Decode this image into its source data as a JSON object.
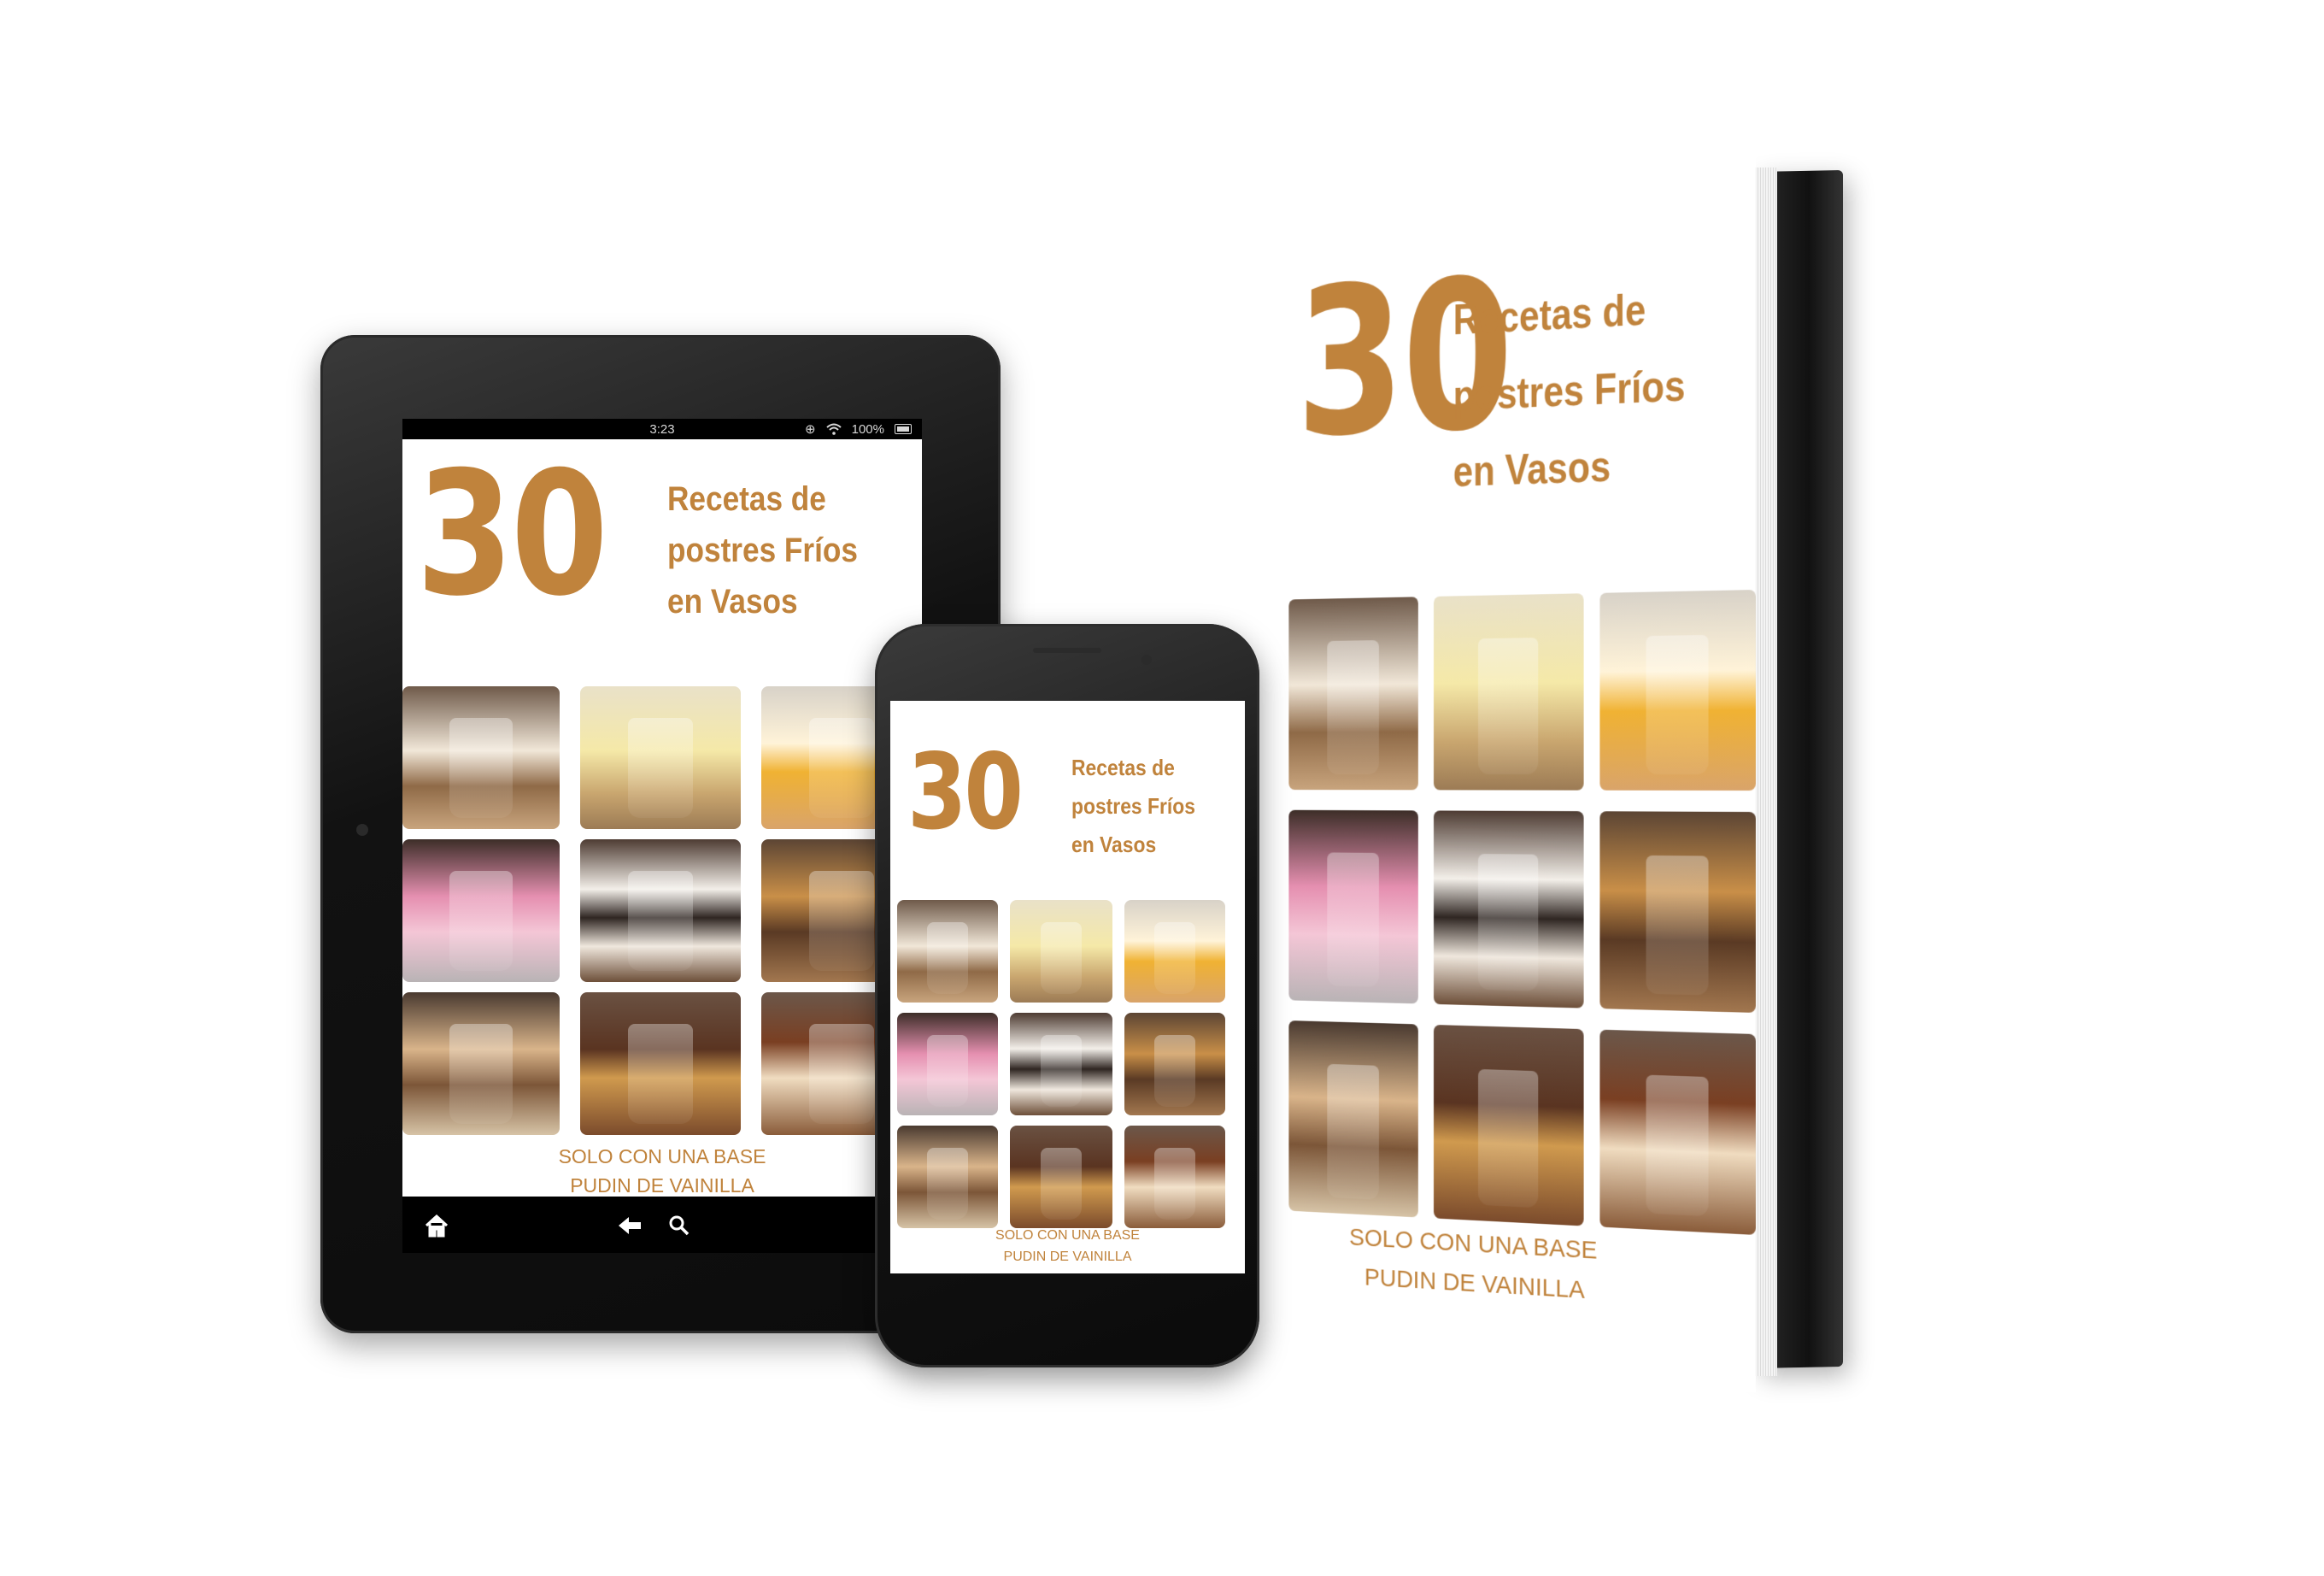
{
  "cover": {
    "number": "30",
    "title_lines": [
      "Recetas de",
      "postres Fríos",
      "en Vasos"
    ],
    "subtitle_lines": [
      "SOLO CON UNA BASE",
      "PUDIN DE VAINILLA"
    ]
  },
  "tablet": {
    "status_time": "3:23",
    "status_battery": "100%"
  },
  "colors": {
    "accent": "#c0833c",
    "device_body": "#121212",
    "background": "#ffffff"
  },
  "icons": [
    "home-icon",
    "back-arrow-icon",
    "search-icon",
    "wifi-icon",
    "battery-icon"
  ]
}
